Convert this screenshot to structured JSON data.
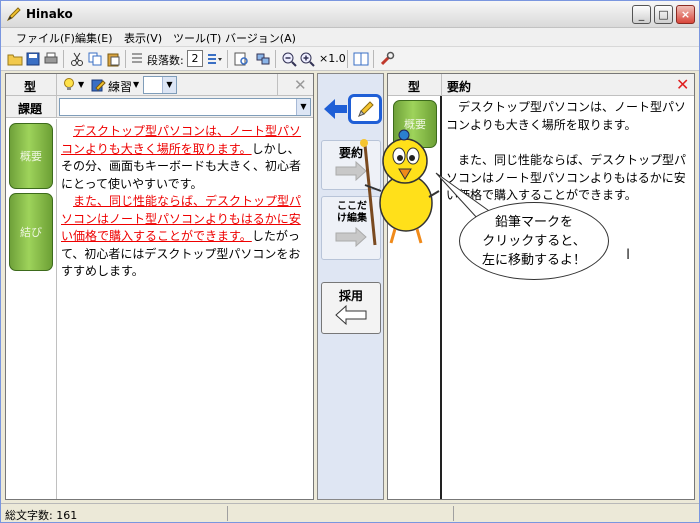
{
  "window": {
    "title": "Hinako"
  },
  "menu": [
    "ファイル(F)",
    "編集(E)",
    "表示(V)",
    "ツール(T)",
    "バージョン(A)"
  ],
  "toolbar": {
    "paragraph_label": "段落数:",
    "paragraph_value": "2",
    "zoom_label": "×1.0"
  },
  "left_panel": {
    "type_label": "型",
    "mode_label": "練習",
    "task_label": "課題",
    "tabs": [
      "概要",
      "結び"
    ],
    "paragraphs": [
      {
        "red": "デスクトップ型パソコンは、ノート型パソコンよりも大きく場所を取ります。",
        "normal": "しかし、その分、画面もキーボードも大きく、初心者にとって使いやすいです。"
      },
      {
        "red": "また、同じ性能ならば、デスクトップ型パソコンはノート型パソコンよりもはるかに安い価格で購入することができます。",
        "normal": "したがって、初心者にはデスクトップ型パソコンをおすすめします。"
      }
    ]
  },
  "middle_panel": {
    "summary_label": "要約",
    "edit_here_label": "ここだけ編集",
    "adopt_label": "採用"
  },
  "right_panel": {
    "type_label": "型",
    "summary_label": "要約",
    "tab": "概要",
    "paragraphs": [
      "デスクトップ型パソコンは、ノート型パソコンよりも大きく場所を取ります。",
      "また、同じ性能ならば、デスクトップ型パソコンはノート型パソコンよりもはるかに安い価格で購入することができます。"
    ]
  },
  "balloon": {
    "lines": [
      "鉛筆マークを",
      "クリックすると、",
      "左に移動するよ！"
    ]
  },
  "status": {
    "char_count": "総文字数: 161"
  },
  "colors": {
    "red_text": "#ee0000",
    "tab_green": "#8cc34b",
    "arrow_blue": "#1f5fd6",
    "mascot_yellow": "#ffe01a"
  }
}
